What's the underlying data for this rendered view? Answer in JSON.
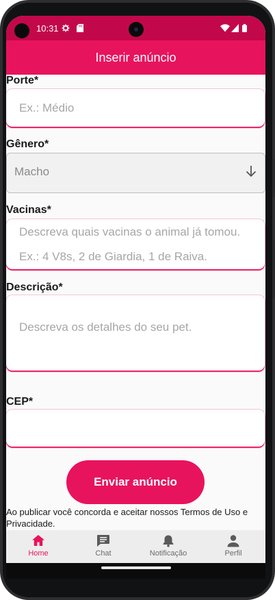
{
  "status_bar": {
    "time": "10:31"
  },
  "app_bar": {
    "title": "Inserir anúncio"
  },
  "form": {
    "porte": {
      "label": "Porte*",
      "placeholder": "Ex.: Médio"
    },
    "genero": {
      "label": "Gênero*",
      "value": "Macho"
    },
    "vacinas": {
      "label": "Vacinas*",
      "placeholder_line1": "Descreva quais vacinas o animal já tomou.",
      "placeholder_line2": "Ex.: 4 V8s, 2 de Giardia, 1 de Raiva."
    },
    "descricao": {
      "label": "Descrição*",
      "placeholder": "Descreva os detalhes do seu pet."
    },
    "cep": {
      "label": "CEP*",
      "value": ""
    },
    "submit_label": "Enviar anúncio",
    "terms_text": "Ao publicar você concorda e aceitar nossos Termos de Uso e Privacidade."
  },
  "bottom_nav": {
    "items": [
      {
        "label": "Home",
        "icon": "home-icon",
        "active": true
      },
      {
        "label": "Chat",
        "icon": "chat-icon",
        "active": false
      },
      {
        "label": "Notificação",
        "icon": "bell-icon",
        "active": false
      },
      {
        "label": "Perfil",
        "icon": "person-icon",
        "active": false
      }
    ]
  },
  "colors": {
    "accent": "#e8135d",
    "status_bar": "#c2084a",
    "nav_inactive": "#6a6a6a"
  }
}
